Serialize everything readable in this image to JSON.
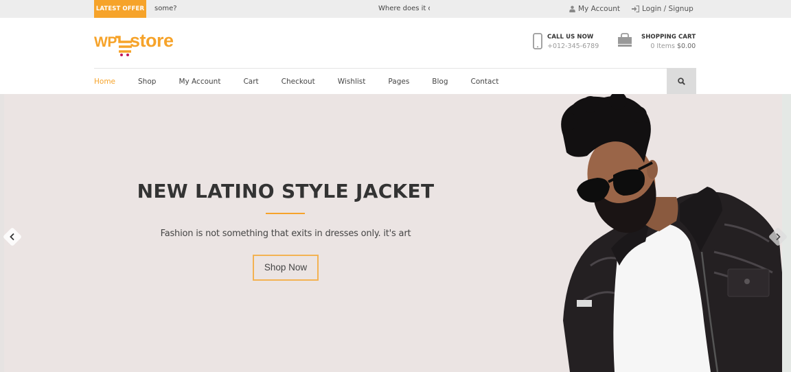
{
  "topbar": {
    "offer_label": "LATEST OFFER",
    "ticker_items": [
      "some?",
      "Where does it co"
    ],
    "links": [
      {
        "label": "My Account",
        "icon": "user-icon"
      },
      {
        "label": "Login / Signup",
        "icon": "sign-in-icon"
      }
    ]
  },
  "header": {
    "logo": {
      "part1": "WP",
      "part2": "store"
    },
    "contact": {
      "title": "CALL US NOW",
      "phone": "+012-345-6789",
      "icon": "mobile-phone-icon"
    },
    "cart": {
      "title": "SHOPPING CART",
      "items": "0 Items",
      "total": "$0.00",
      "icon": "shopping-bag-icon"
    }
  },
  "nav": {
    "items": [
      {
        "label": "Home",
        "active": true
      },
      {
        "label": "Shop"
      },
      {
        "label": "My Account"
      },
      {
        "label": "Cart"
      },
      {
        "label": "Checkout"
      },
      {
        "label": "Wishlist"
      },
      {
        "label": "Pages"
      },
      {
        "label": "Blog"
      },
      {
        "label": "Contact"
      }
    ],
    "search_icon": "search-icon"
  },
  "hero": {
    "title": "NEW LATINO STYLE JACKET",
    "subtitle": "Fashion is not something that exits in  dresses only. it's art",
    "button_label": "Shop Now",
    "image_alt": "Man with beard and sunglasses in black leather jacket",
    "prev_icon": "chevron-left-icon",
    "next_icon": "chevron-right-icon"
  },
  "colors": {
    "accent": "#f6a32a",
    "topbar_bg": "#ededed",
    "hero_bg": "#ebe4e3",
    "search_bg": "#dcdcdc",
    "cart_dots": "#c2185b"
  }
}
